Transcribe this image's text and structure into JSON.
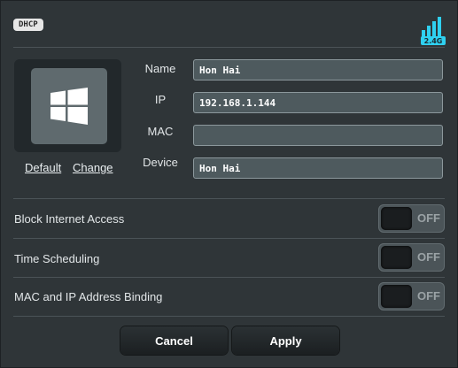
{
  "header": {
    "badge": "DHCP",
    "band_label": "2.4G"
  },
  "profile": {
    "icon": "windows-logo-icon",
    "default_link": "Default",
    "change_link": "Change"
  },
  "fields": {
    "name": {
      "label": "Name",
      "value": "Hon Hai"
    },
    "ip": {
      "label": "IP",
      "value": "192.168.1.144"
    },
    "mac": {
      "label": "MAC",
      "value": ""
    },
    "device": {
      "label": "Device",
      "value": "Hon Hai"
    }
  },
  "toggles": [
    {
      "label": "Block Internet Access",
      "state": "OFF"
    },
    {
      "label": "Time Scheduling",
      "state": "OFF"
    },
    {
      "label": "MAC and IP Address Binding",
      "state": "OFF"
    }
  ],
  "buttons": {
    "cancel": "Cancel",
    "apply": "Apply"
  },
  "colors": {
    "accent_signal": "#2fd0f0",
    "panel_bg": "#2f3538"
  }
}
